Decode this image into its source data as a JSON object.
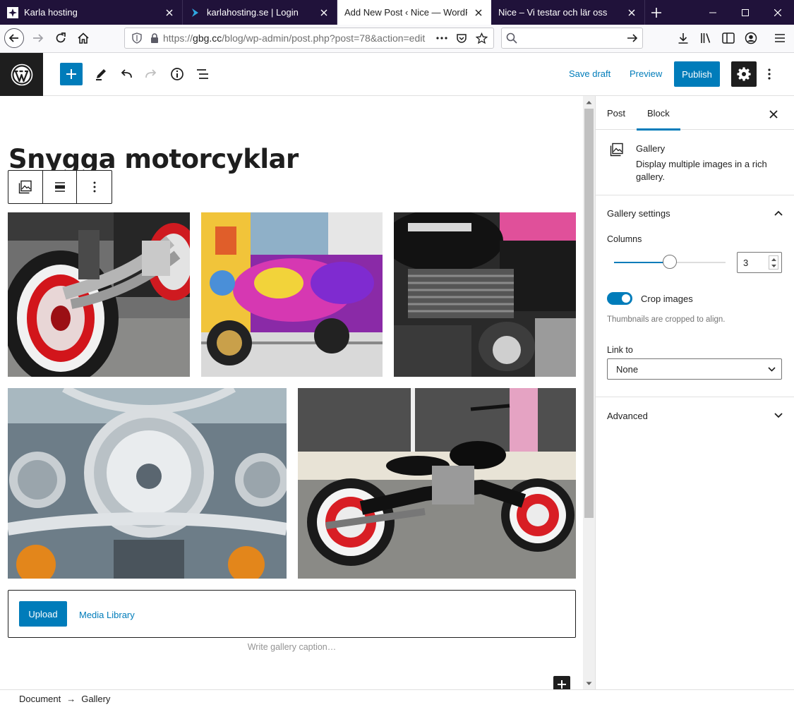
{
  "browser": {
    "tabs": [
      {
        "title": "Karla hosting",
        "active": false
      },
      {
        "title": "karlahosting.se | Login",
        "active": false
      },
      {
        "title": "Add New Post ‹ Nice — WordPress",
        "active": true
      },
      {
        "title": "Nice – Vi testar och lär oss",
        "active": false
      }
    ],
    "url": {
      "prefix": "https://",
      "domain": "gbg.cc",
      "path": "/blog/wp-admin/post.php?post=78&action=edit"
    },
    "search_placeholder": ""
  },
  "header": {
    "save_draft_label": "Save draft",
    "preview_label": "Preview",
    "publish_label": "Publish"
  },
  "editor": {
    "post_title": "Snygga motorcyklar",
    "upload_label": "Upload",
    "media_library_label": "Media Library",
    "caption_placeholder": "Write gallery caption…"
  },
  "sidebar": {
    "tabs": {
      "post": "Post",
      "block": "Block"
    },
    "block_card": {
      "title": "Gallery",
      "description": "Display multiple images in a rich gallery."
    },
    "gallery_settings": {
      "title": "Gallery settings",
      "columns_label": "Columns",
      "columns_value": "3",
      "columns_min": 1,
      "columns_max": 5,
      "crop_label": "Crop images",
      "crop_enabled": true,
      "crop_help": "Thumbnails are cropped to align.",
      "link_to_label": "Link to",
      "link_to_value": "None"
    },
    "advanced_title": "Advanced"
  },
  "breadcrumb": {
    "document": "Document",
    "arrow": "→",
    "current": "Gallery"
  },
  "colors": {
    "accent": "#007cba",
    "dark": "#1e1e1e",
    "tabstrip": "#20123a"
  }
}
